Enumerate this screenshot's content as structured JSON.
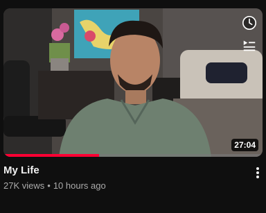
{
  "video": {
    "title": "My Life",
    "views": "27K views",
    "separator": "•",
    "age": "10 hours ago",
    "duration": "27:04",
    "watch_progress_percent": 37
  },
  "icons": {
    "clock": "watch-later-icon",
    "queue": "add-to-queue-icon",
    "menu": "more-vert-icon"
  },
  "colors": {
    "background": "#0f0f0f",
    "progress": "#ff0033",
    "title": "#f1f1f1",
    "meta": "#aaaaaa"
  }
}
